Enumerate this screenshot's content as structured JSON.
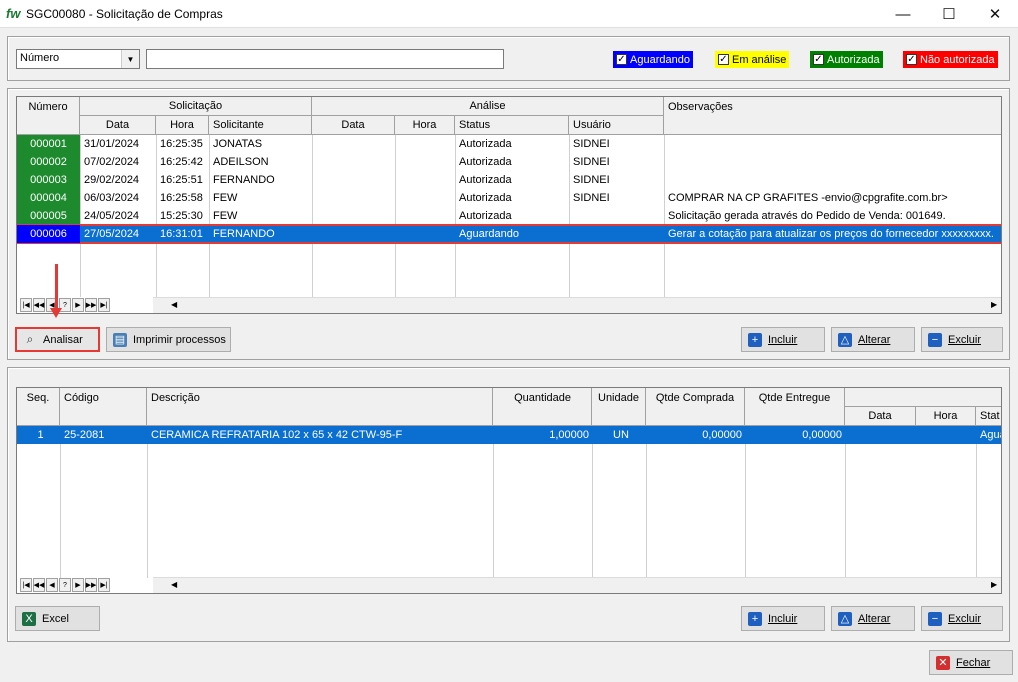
{
  "window": {
    "logo": "fw",
    "title": "SGC00080 - Solicitação de Compras",
    "minimize": "—",
    "maximize": "☐",
    "close": "✕"
  },
  "filter": {
    "field": "Número",
    "search_value": "",
    "statuses": [
      {
        "label": "Aguardando",
        "color": "#0000ff"
      },
      {
        "label": "Em análise",
        "color": "#ffff00"
      },
      {
        "label": "Autorizada",
        "color": "#008000"
      },
      {
        "label": "Não autorizada",
        "color": "#ff0000"
      }
    ]
  },
  "requests": {
    "group_headers": {
      "number": "Número",
      "request": "Solicitação",
      "analysis": "Análise",
      "notes": "Observações"
    },
    "columns": {
      "date": "Data",
      "time": "Hora",
      "requester": "Solicitante",
      "a_date": "Data",
      "a_time": "Hora",
      "status": "Status",
      "user": "Usuário"
    },
    "rows": [
      {
        "num": "000001",
        "date": "31/01/2024",
        "time": "16:25:35",
        "requester": "JONATAS",
        "a_date": "",
        "a_time": "",
        "status": "Autorizada",
        "user": "SIDNEI",
        "notes": ""
      },
      {
        "num": "000002",
        "date": "07/02/2024",
        "time": "16:25:42",
        "requester": "ADEILSON",
        "a_date": "",
        "a_time": "",
        "status": "Autorizada",
        "user": "SIDNEI",
        "notes": ""
      },
      {
        "num": "000003",
        "date": "29/02/2024",
        "time": "16:25:51",
        "requester": "FERNANDO",
        "a_date": "",
        "a_time": "",
        "status": "Autorizada",
        "user": "SIDNEI",
        "notes": ""
      },
      {
        "num": "000004",
        "date": "06/03/2024",
        "time": "16:25:58",
        "requester": "FEW",
        "a_date": "",
        "a_time": "",
        "status": "Autorizada",
        "user": "SIDNEI",
        "notes": "COMPRAR NA CP GRAFITES -envio@cpgrafite.com.br>"
      },
      {
        "num": "000005",
        "date": "24/05/2024",
        "time": "15:25:30",
        "requester": "FEW",
        "a_date": "",
        "a_time": "",
        "status": "Autorizada",
        "user": "",
        "notes": "Solicitação gerada através do Pedido de Venda: 001649."
      },
      {
        "num": "000006",
        "date": "27/05/2024",
        "time": "16:31:01",
        "requester": "FERNANDO",
        "a_date": "",
        "a_time": "",
        "status": "Aguardando",
        "user": "",
        "notes": "Gerar a cotação para atualizar os preços do fornecedor xxxxxxxxx."
      }
    ],
    "selected_index": 5
  },
  "nav": [
    "|◀",
    "◀◀",
    "◀",
    "?",
    "▶",
    "▶▶",
    "▶|"
  ],
  "buttons_top": {
    "analyze": "Analisar",
    "print": "Imprimir processos",
    "add": "Incluir",
    "edit": "Alterar",
    "delete": "Excluir"
  },
  "items": {
    "columns": {
      "seq": "Seq.",
      "code": "Código",
      "desc": "Descrição",
      "qty": "Quantidade",
      "unit": "Unidade",
      "qty_bought": "Qtde Comprada",
      "qty_delivered": "Qtde Entregue",
      "date": "Data",
      "time": "Hora",
      "status": "Stat"
    },
    "rows": [
      {
        "seq": "1",
        "code": "25-2081",
        "desc": "CERAMICA REFRATARIA 102 x 65 x 42 CTW-95-F",
        "qty": "1,00000",
        "unit": "UN",
        "qty_bought": "0,00000",
        "qty_delivered": "0,00000",
        "date": "",
        "time": "",
        "status": "Agua"
      }
    ]
  },
  "buttons_bottom": {
    "excel": "Excel",
    "add": "Incluir",
    "edit": "Alterar",
    "delete": "Excluir"
  },
  "close_label": "Fechar",
  "colors": {
    "highlight": "#e53935",
    "selection": "#0a6fd1",
    "authorized": "#1e8a2e",
    "awaiting": "#0000ff"
  }
}
